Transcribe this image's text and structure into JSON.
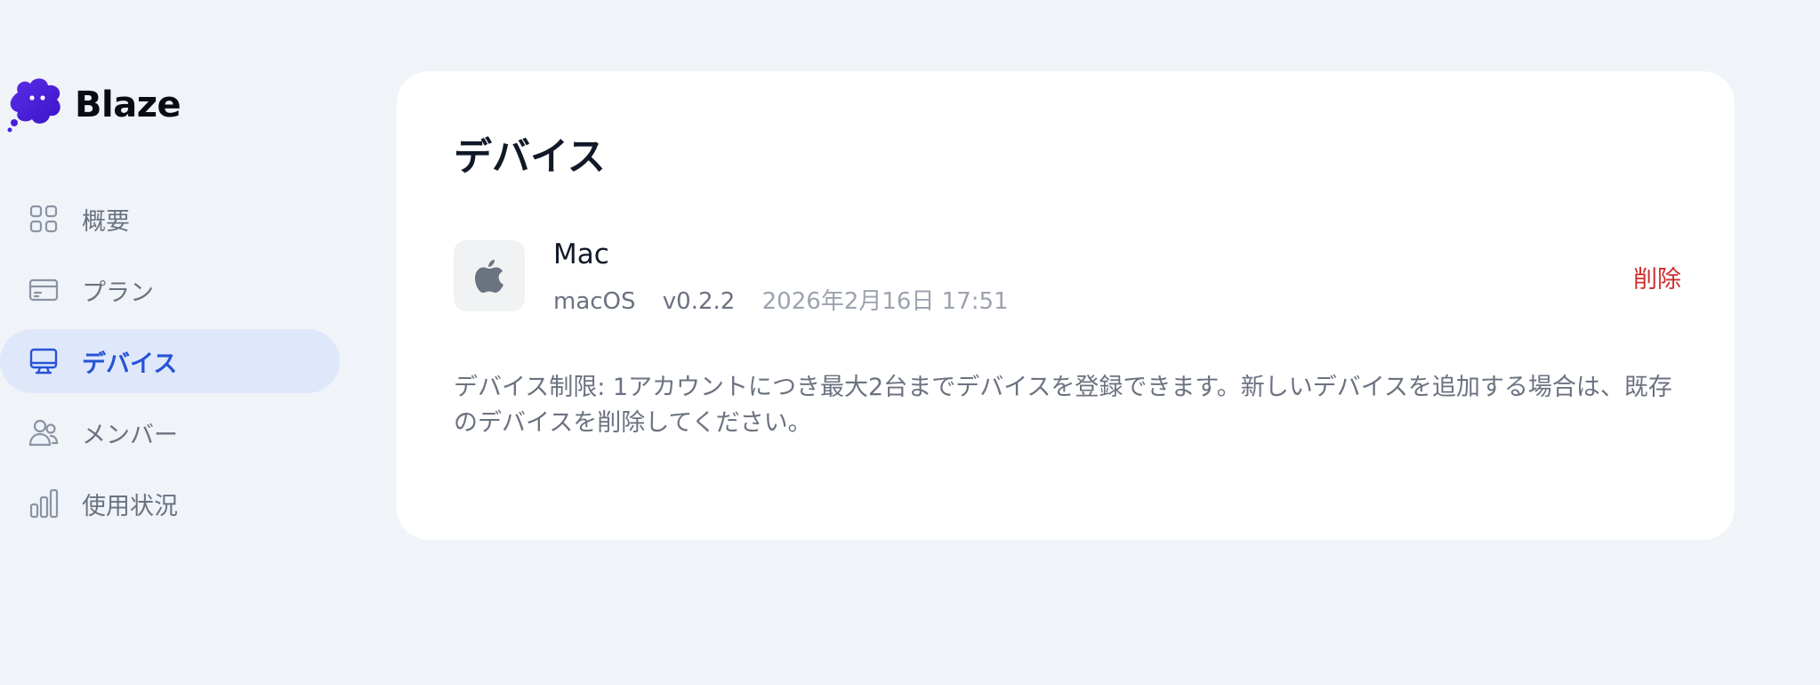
{
  "app": {
    "name": "Blaze"
  },
  "sidebar": {
    "items": [
      {
        "label": "概要",
        "icon": "grid-icon",
        "active": false
      },
      {
        "label": "プラン",
        "icon": "credit-card-icon",
        "active": false
      },
      {
        "label": "デバイス",
        "icon": "monitor-icon",
        "active": true
      },
      {
        "label": "メンバー",
        "icon": "users-icon",
        "active": false
      },
      {
        "label": "使用状況",
        "icon": "bar-chart-icon",
        "active": false
      }
    ]
  },
  "main": {
    "title": "デバイス",
    "devices": [
      {
        "name": "Mac",
        "icon": "apple-icon",
        "os": "macOS",
        "version": "v0.2.2",
        "registered": "2026年2月16日 17:51",
        "delete_label": "削除"
      }
    ],
    "limit_note": "デバイス制限: 1アカウントにつき最大2台までデバイスを登録できます。新しいデバイスを追加する場合は、既存のデバイスを削除してください。"
  },
  "colors": {
    "background": "#f0f3f8",
    "accent": "#2753d6",
    "active_bg": "#dfe8fb",
    "danger": "#cc2e2e",
    "brand": "#4a1fd8"
  }
}
